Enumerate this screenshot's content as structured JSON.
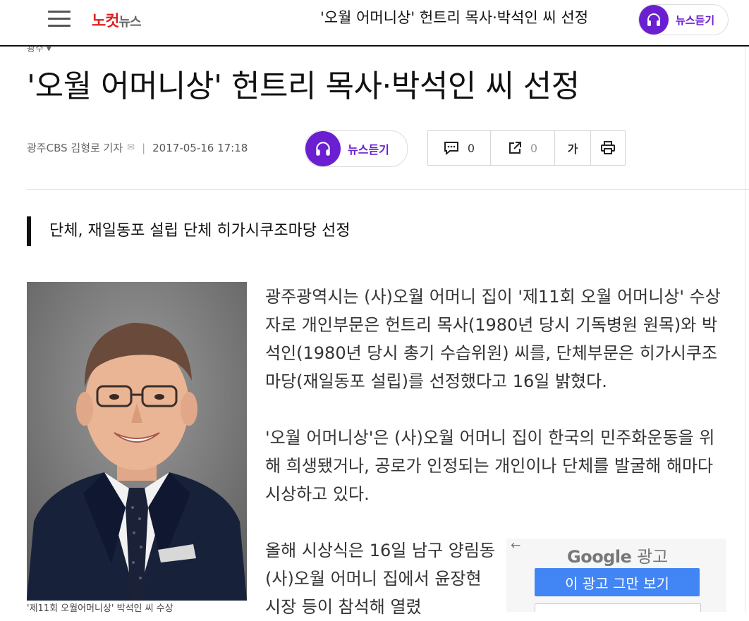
{
  "header": {
    "menu_icon": "hamburger-menu-icon",
    "logo_red": "노컷",
    "logo_gray": "뉴스",
    "title": "'오월 어머니상' 헌트리 목사·박석인 씨 선정",
    "listen_label": "뉴스듣기"
  },
  "breadcrumb": "광주",
  "article": {
    "headline": "'오월 어머니상' 헌트리 목사·박석인 씨 선정",
    "byline": "광주CBS 김형로 기자",
    "date": "2017-05-16 17:18",
    "listen_label": "뉴스듣기",
    "comment_count": "0",
    "share_count": "0",
    "font_size_label": "가",
    "subtitle": "단체, 재일동포 설립 단체 히가시쿠조마당 선정",
    "photo_caption": "'제11회 오월어머니상' 박석인 씨 수상",
    "paragraphs": [
      "광주광역시는 (사)오월 어머니 집이 '제11회 오월 어머니상' 수상자로 개인부문은 헌트리 목사(1980년 당시 기독병원 원목)와 박석인(1980년 당시 총기 수습위원) 씨를, 단체부문은 히가시쿠조마당(재일동포 설립)를 선정했다고 16일 밝혔다.",
      "'오월 어머니상'은 (사)오월 어머니 집이 한국의 민주화운동을 위해 희생됐거나, 공로가 인정되는 개인이나 단체를 발굴해 해마다 시상하고 있다.",
      "올해 시상식은 16일 남구 양림동 (사)오월 어머니 집에서 윤장현 시장 등이 참석해 열렸"
    ]
  },
  "ad": {
    "brand": "Google",
    "brand_suffix": "광고",
    "stop_button": "이 광고 그만 보기"
  },
  "colors": {
    "accent_purple": "#6a1fd0",
    "logo_red": "#e02020",
    "ad_blue": "#4285f4"
  }
}
